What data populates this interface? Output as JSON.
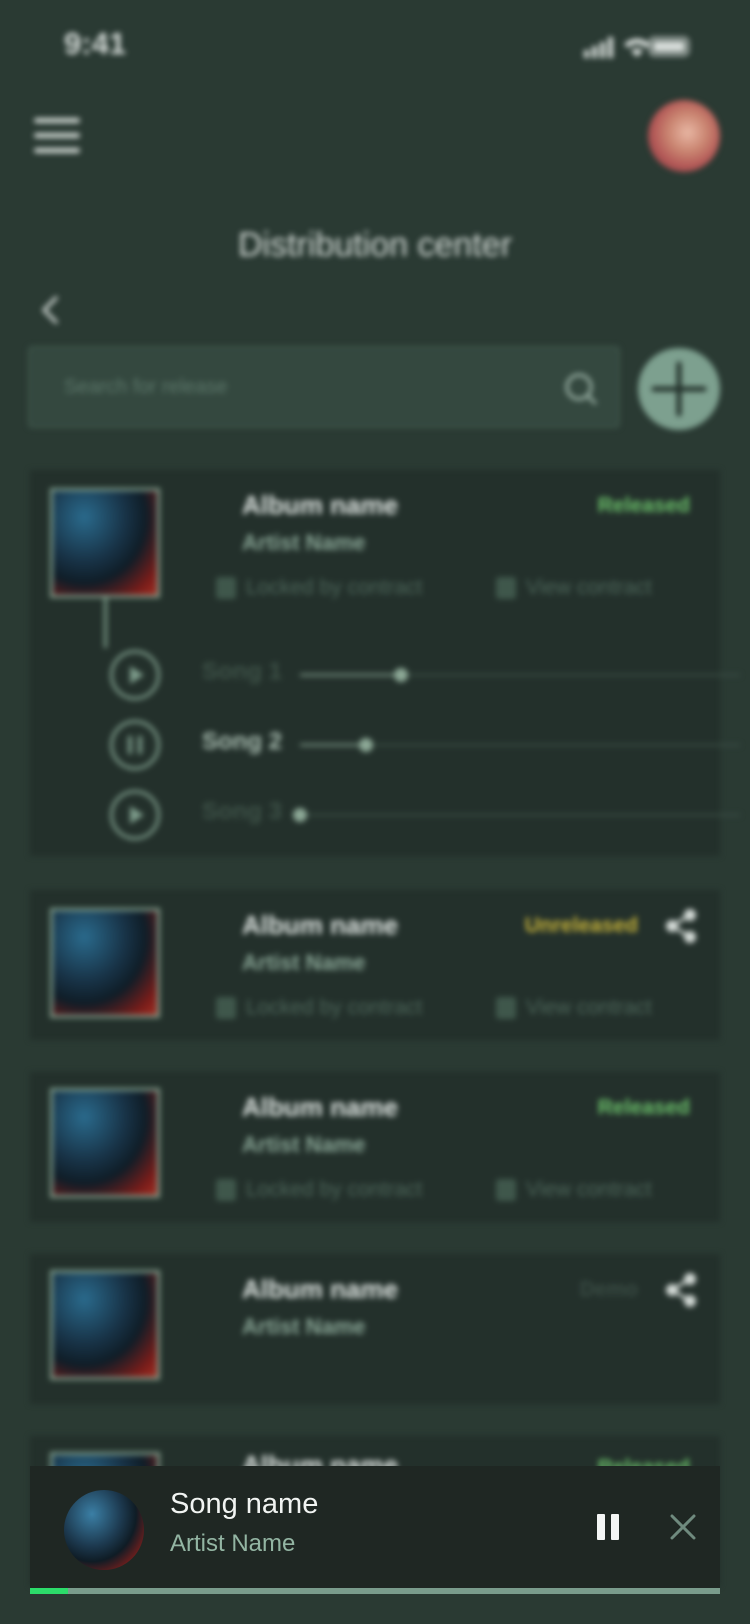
{
  "status_bar": {
    "time": "9:41"
  },
  "header": {
    "title": "Distribution center"
  },
  "search": {
    "placeholder": "Search for release"
  },
  "labels": {
    "locked": "Locked by contract",
    "view_contract": "View contract"
  },
  "colors": {
    "released": "#6cc26b",
    "unreleased": "#c9b53a",
    "demo": "#3a4c44",
    "accent": "#7da08f",
    "progress": "#2cdc6a"
  },
  "releases": [
    {
      "album": "Album name",
      "artist": "Artist Name",
      "status": "Released",
      "songs": [
        {
          "label": "Song 1",
          "state": "play",
          "progress": 0.23
        },
        {
          "label": "Song 2",
          "state": "pause",
          "progress": 0.15
        },
        {
          "label": "Song 3",
          "state": "play",
          "progress": 0.0
        }
      ]
    },
    {
      "album": "Album name",
      "artist": "Artist Name",
      "status": "Unreleased",
      "share_icon": "share-icon"
    },
    {
      "album": "Album name",
      "artist": "Artist Name",
      "status": "Released"
    },
    {
      "album": "Album name",
      "artist": "Artist Name",
      "status": "Demo",
      "share_icon": "share-icon"
    },
    {
      "album": "Album name",
      "status": "Released"
    }
  ],
  "player": {
    "song": "Song name",
    "artist": "Artist Name",
    "progress": 0.055
  }
}
